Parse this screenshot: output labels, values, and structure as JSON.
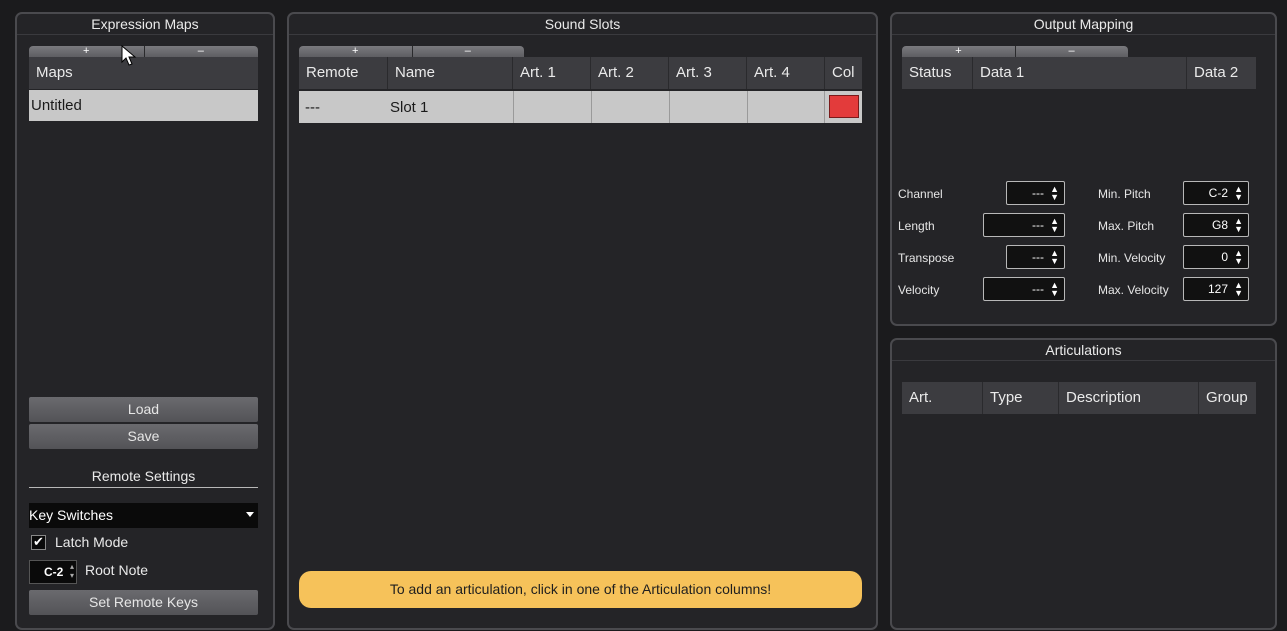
{
  "expression_maps": {
    "title": "Expression Maps",
    "add_label": "+",
    "remove_label": "–",
    "maps_header": "Maps",
    "maps": [
      "Untitled"
    ],
    "load_label": "Load",
    "save_label": "Save",
    "remote_settings_title": "Remote Settings",
    "remote_type": "Key Switches",
    "latch_mode_label": "Latch Mode",
    "latch_mode_checked": true,
    "root_note_value": "C-2",
    "root_note_label": "Root Note",
    "set_remote_keys_label": "Set Remote Keys"
  },
  "sound_slots": {
    "title": "Sound Slots",
    "add_label": "+",
    "remove_label": "–",
    "columns": [
      "Remote",
      "Name",
      "Art. 1",
      "Art. 2",
      "Art. 3",
      "Art. 4",
      "Col"
    ],
    "rows": [
      {
        "remote": "---",
        "name": "Slot 1",
        "art1": "",
        "art2": "",
        "art3": "",
        "art4": "",
        "color": "#e33b3b"
      }
    ],
    "hint": "To add an articulation, click in one of the Articulation columns!"
  },
  "output_mapping": {
    "title": "Output Mapping",
    "add_label": "+",
    "remove_label": "–",
    "columns": [
      "Status",
      "Data 1",
      "Data 2"
    ],
    "left_fields": [
      {
        "label": "Channel",
        "value": "---"
      },
      {
        "label": "Length",
        "value": "---"
      },
      {
        "label": "Transpose",
        "value": "---"
      },
      {
        "label": "Velocity",
        "value": "---"
      }
    ],
    "right_fields": [
      {
        "label": "Min. Pitch",
        "value": "C-2"
      },
      {
        "label": "Max. Pitch",
        "value": "G8"
      },
      {
        "label": "Min. Velocity",
        "value": "0"
      },
      {
        "label": "Max. Velocity",
        "value": "127"
      }
    ]
  },
  "articulations": {
    "title": "Articulations",
    "columns": [
      "Art.",
      "Type",
      "Description",
      "Group"
    ]
  },
  "colors": {
    "hint_bg": "#f6c25a",
    "slot_color": "#e33b3b",
    "selected_row": "#c8c8c8"
  }
}
